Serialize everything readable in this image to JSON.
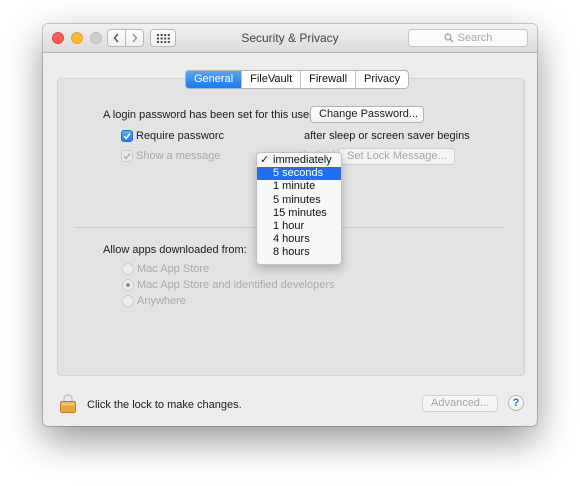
{
  "window": {
    "title": "Security & Privacy",
    "search_placeholder": "Search",
    "traffic_lights": [
      "close",
      "minimize",
      "zoom"
    ],
    "nav": {
      "back_icon": "chevron-left-icon",
      "forward_icon": "chevron-right-icon",
      "grid_icon": "grid-icon"
    }
  },
  "tabs": [
    {
      "label": "General",
      "active": true
    },
    {
      "label": "FileVault",
      "active": false
    },
    {
      "label": "Firewall",
      "active": false
    },
    {
      "label": "Privacy",
      "active": false
    }
  ],
  "general": {
    "login_password_text": "A login password has been set for this user",
    "change_password_label": "Change Password...",
    "require_password_label": "Require passworc",
    "require_password_checked": true,
    "after_sleep_text": "after sleep or screen saver begins",
    "show_message_label": "Show a message",
    "show_message_checked": true,
    "locked_text": "locked",
    "set_lock_message_label": "Set Lock Message...",
    "dropdown": {
      "selected": "immediately",
      "highlighted": "5 seconds",
      "options": [
        "immediately",
        "5 seconds",
        "1 minute",
        "5 minutes",
        "15 minutes",
        "1 hour",
        "4 hours",
        "8 hours"
      ]
    },
    "allow_apps_label": "Allow apps downloaded from:",
    "allow_options": [
      {
        "label": "Mac App Store",
        "selected": false
      },
      {
        "label": "Mac App Store and identified developers",
        "selected": true
      },
      {
        "label": "Anywhere",
        "selected": false
      }
    ]
  },
  "footer": {
    "lock_text": "Click the lock to make changes.",
    "advanced_label": "Advanced...",
    "help_label": "?"
  },
  "colors": {
    "accent": "#1f6ff2",
    "close": "#fc5f57",
    "minimize": "#fdbc2e",
    "lock": "#e8a33a"
  }
}
